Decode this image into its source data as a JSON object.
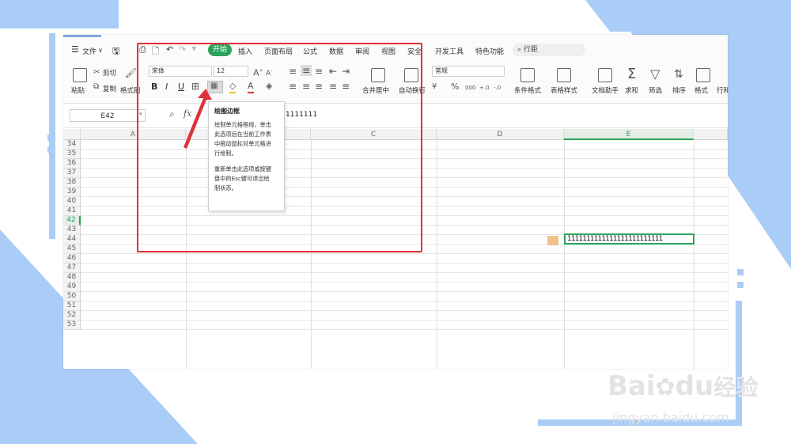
{
  "menu": {
    "file": "文件",
    "items": [
      "插入",
      "页面布局",
      "公式",
      "数据",
      "审阅",
      "视图",
      "安全",
      "开发工具",
      "特色功能"
    ],
    "active_tab": "开始",
    "search": "行距"
  },
  "ribbon": {
    "paste": "粘贴",
    "cut": "剪切",
    "copy": "复制",
    "format_painter": "格式刷",
    "font_name": "宋体",
    "font_size": "12",
    "bold": "B",
    "italic": "I",
    "underline": "U",
    "merge_center": "合并居中",
    "wrap": "自动换行",
    "number_format": "常规",
    "percent": "%",
    "thousands": "000",
    "cond_format": "条件格式",
    "table_style": "表格样式",
    "doc_helper": "文档助手",
    "sum": "求和",
    "filter": "筛选",
    "sort": "排序",
    "format": "格式",
    "rowcol": "行和"
  },
  "formula_bar": {
    "name_box": "E42",
    "fx": "fx",
    "value": "1111111"
  },
  "grid": {
    "columns": [
      "A",
      "C",
      "D",
      "E"
    ],
    "rows": [
      "34",
      "35",
      "36",
      "37",
      "38",
      "39",
      "40",
      "41",
      "42",
      "43",
      "44",
      "45",
      "46",
      "47",
      "48",
      "49",
      "50",
      "51",
      "52",
      "53"
    ],
    "cell_e42": "1111111111111111111111111"
  },
  "tooltip": {
    "title": "绘图边框",
    "line1": "绘制单元格框线，单击",
    "line2": "此选项后在当前工作表",
    "line3": "中拖动鼠标对单元格进",
    "line4": "行绘制。",
    "line5": "重新单击此选项或按键",
    "line6": "盘中的Esc键可退出绘",
    "line7": "制状态。"
  },
  "watermark": {
    "brand_a": "Bai",
    "brand_b": "du",
    "brand_c": "经验",
    "url": "jingyan.baidu.com"
  },
  "colors": {
    "accent_green": "#2aa35a",
    "highlight_red": "#e0303a",
    "frame_blue": "#a9cdf7"
  }
}
